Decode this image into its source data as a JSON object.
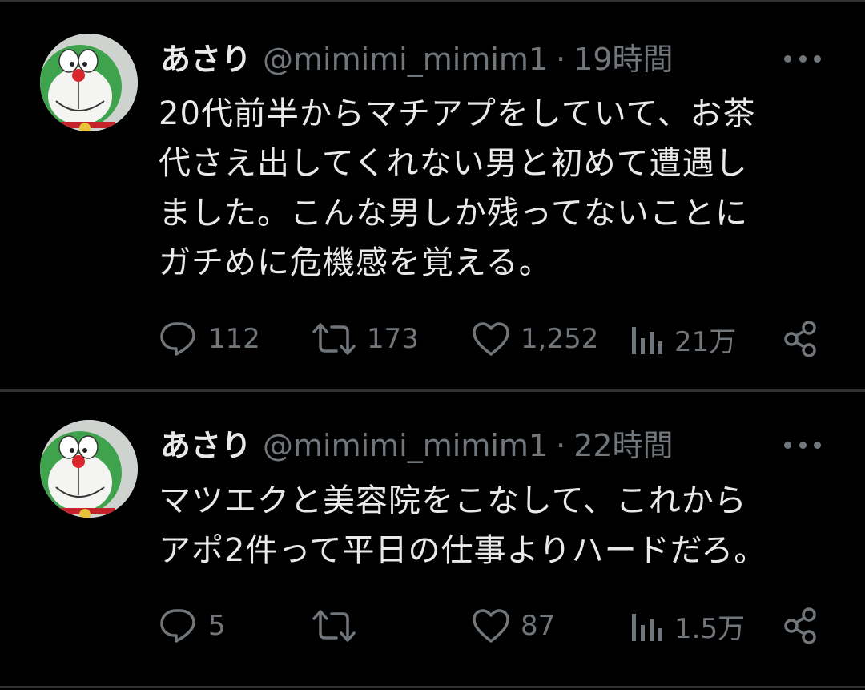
{
  "tweets": [
    {
      "name": "あさり",
      "handle": "@mimimi_mimim1",
      "separator": "·",
      "time": "19時間",
      "text_lines": [
        "20代前半からマチアプをしていて、お茶",
        "代さえ出してくれない男と初めて遭遇し",
        "ました。こんな男しか残ってないことに",
        "ガチめに危機感を覚える。"
      ],
      "replies": "112",
      "retweets": "173",
      "likes": "1,252",
      "views": "21万"
    },
    {
      "name": "あさり",
      "handle": "@mimimi_mimim1",
      "separator": "·",
      "time": "22時間",
      "text_lines": [
        "マツエクと美容院をこなして、これから",
        "アポ2件って平日の仕事よりハードだろ。"
      ],
      "replies": "5",
      "retweets": "",
      "likes": "87",
      "views": "1.5万"
    }
  ],
  "icons": {
    "reply": "reply-icon",
    "retweet": "retweet-icon",
    "like": "heart-icon",
    "views": "views-icon",
    "share": "share-icon",
    "more": "more-icon"
  },
  "colors": {
    "background": "#000000",
    "text": "#e7e9ea",
    "secondary": "#71767b",
    "divider": "#2f3336",
    "avatar_green": "#3fa34d"
  }
}
